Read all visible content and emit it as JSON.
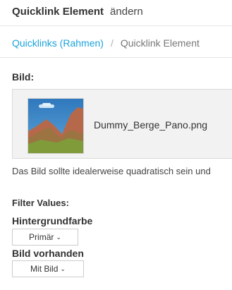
{
  "header": {
    "title": "Quicklink Element",
    "action": "ändern"
  },
  "breadcrumb": {
    "parent_label": "Quicklinks (Rahmen)",
    "separator": "/",
    "current_label": "Quicklink Element"
  },
  "image_field": {
    "label": "Bild:",
    "filename": "Dummy_Berge_Pano.png",
    "thumbnail_icon": "mountain-landscape-thumbnail",
    "hint": "Das Bild sollte idealerweise quadratisch sein und"
  },
  "filters": {
    "heading": "Filter Values:",
    "background_color": {
      "label": "Hintergrundfarbe",
      "selected": "Primär"
    },
    "image_present": {
      "label": "Bild vorhanden",
      "selected": "Mit Bild"
    }
  },
  "colors": {
    "link": "#1aa3d9",
    "sky": "#3a84c2",
    "mountain": "#b5694a",
    "meadow": "#7f9b3a"
  }
}
